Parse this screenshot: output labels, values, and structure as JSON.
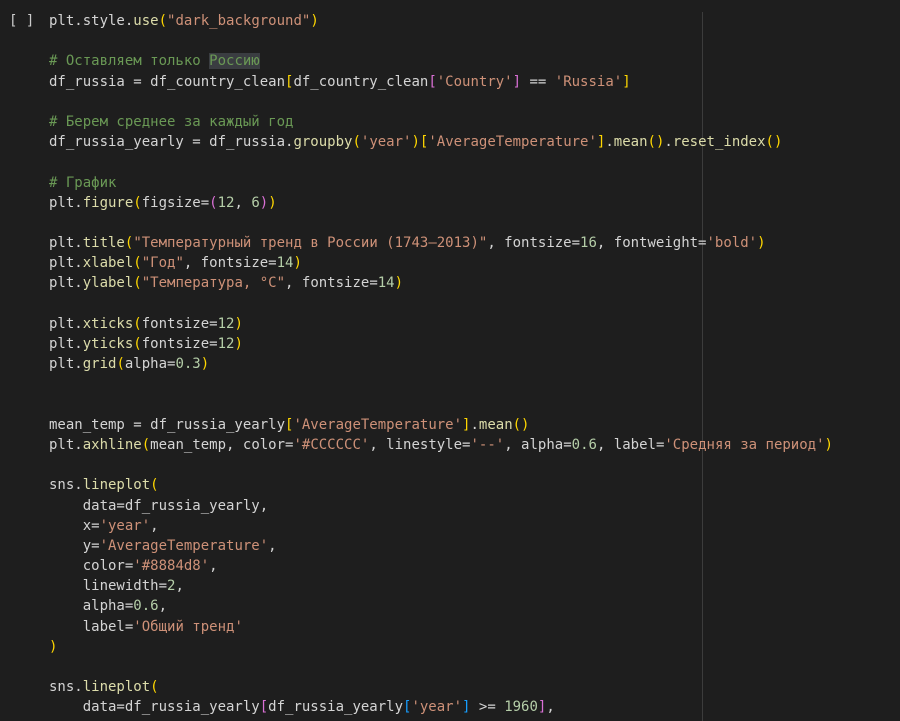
{
  "cell": {
    "run_indicator": "[ ]"
  },
  "code_lines": [
    [
      {
        "t": "plt.style.",
        "c": "plain"
      },
      {
        "t": "use",
        "c": "func"
      },
      {
        "t": "(",
        "c": "b1"
      },
      {
        "t": "\"dark_background\"",
        "c": "str"
      },
      {
        "t": ")",
        "c": "b1"
      }
    ],
    [],
    [
      {
        "t": "# Оставляем только ",
        "c": "comment"
      },
      {
        "t": "Россию",
        "c": "comment",
        "hl": true
      }
    ],
    [
      {
        "t": "df_russia = df_country_clean",
        "c": "plain"
      },
      {
        "t": "[",
        "c": "b1"
      },
      {
        "t": "df_country_clean",
        "c": "plain"
      },
      {
        "t": "[",
        "c": "b2"
      },
      {
        "t": "'Country'",
        "c": "str"
      },
      {
        "t": "]",
        "c": "b2"
      },
      {
        "t": " == ",
        "c": "plain"
      },
      {
        "t": "'Russia'",
        "c": "str"
      },
      {
        "t": "]",
        "c": "b1"
      }
    ],
    [],
    [
      {
        "t": "# Берем среднее за каждый год",
        "c": "comment"
      }
    ],
    [
      {
        "t": "df_russia_yearly = df_russia.",
        "c": "plain"
      },
      {
        "t": "groupby",
        "c": "func"
      },
      {
        "t": "(",
        "c": "b1"
      },
      {
        "t": "'year'",
        "c": "str"
      },
      {
        "t": ")",
        "c": "b1"
      },
      {
        "t": "[",
        "c": "b1"
      },
      {
        "t": "'AverageTemperature'",
        "c": "str"
      },
      {
        "t": "]",
        "c": "b1"
      },
      {
        "t": ".",
        "c": "plain"
      },
      {
        "t": "mean",
        "c": "func"
      },
      {
        "t": "()",
        "c": "b1"
      },
      {
        "t": ".",
        "c": "plain"
      },
      {
        "t": "reset_index",
        "c": "func"
      },
      {
        "t": "()",
        "c": "b1"
      }
    ],
    [],
    [
      {
        "t": "# График",
        "c": "comment"
      }
    ],
    [
      {
        "t": "plt.",
        "c": "plain"
      },
      {
        "t": "figure",
        "c": "func"
      },
      {
        "t": "(",
        "c": "b1"
      },
      {
        "t": "figsize=",
        "c": "plain"
      },
      {
        "t": "(",
        "c": "b2"
      },
      {
        "t": "12",
        "c": "num"
      },
      {
        "t": ", ",
        "c": "plain"
      },
      {
        "t": "6",
        "c": "num"
      },
      {
        "t": ")",
        "c": "b2"
      },
      {
        "t": ")",
        "c": "b1"
      }
    ],
    [],
    [
      {
        "t": "plt.",
        "c": "plain"
      },
      {
        "t": "title",
        "c": "func"
      },
      {
        "t": "(",
        "c": "b1"
      },
      {
        "t": "\"Температурный тренд в России (1743–2013)\"",
        "c": "str"
      },
      {
        "t": ", fontsize=",
        "c": "plain"
      },
      {
        "t": "16",
        "c": "num"
      },
      {
        "t": ", fontweight=",
        "c": "plain"
      },
      {
        "t": "'bold'",
        "c": "str"
      },
      {
        "t": ")",
        "c": "b1"
      }
    ],
    [
      {
        "t": "plt.",
        "c": "plain"
      },
      {
        "t": "xlabel",
        "c": "func"
      },
      {
        "t": "(",
        "c": "b1"
      },
      {
        "t": "\"Год\"",
        "c": "str"
      },
      {
        "t": ", fontsize=",
        "c": "plain"
      },
      {
        "t": "14",
        "c": "num"
      },
      {
        "t": ")",
        "c": "b1"
      }
    ],
    [
      {
        "t": "plt.",
        "c": "plain"
      },
      {
        "t": "ylabel",
        "c": "func"
      },
      {
        "t": "(",
        "c": "b1"
      },
      {
        "t": "\"Температура, °C\"",
        "c": "str"
      },
      {
        "t": ", fontsize=",
        "c": "plain"
      },
      {
        "t": "14",
        "c": "num"
      },
      {
        "t": ")",
        "c": "b1"
      }
    ],
    [],
    [
      {
        "t": "plt.",
        "c": "plain"
      },
      {
        "t": "xticks",
        "c": "func"
      },
      {
        "t": "(",
        "c": "b1"
      },
      {
        "t": "fontsize=",
        "c": "plain"
      },
      {
        "t": "12",
        "c": "num"
      },
      {
        "t": ")",
        "c": "b1"
      }
    ],
    [
      {
        "t": "plt.",
        "c": "plain"
      },
      {
        "t": "yticks",
        "c": "func"
      },
      {
        "t": "(",
        "c": "b1"
      },
      {
        "t": "fontsize=",
        "c": "plain"
      },
      {
        "t": "12",
        "c": "num"
      },
      {
        "t": ")",
        "c": "b1"
      }
    ],
    [
      {
        "t": "plt.",
        "c": "plain"
      },
      {
        "t": "grid",
        "c": "func"
      },
      {
        "t": "(",
        "c": "b1"
      },
      {
        "t": "alpha=",
        "c": "plain"
      },
      {
        "t": "0.3",
        "c": "num"
      },
      {
        "t": ")",
        "c": "b1"
      }
    ],
    [],
    [],
    [
      {
        "t": "mean_temp = df_russia_yearly",
        "c": "plain"
      },
      {
        "t": "[",
        "c": "b1"
      },
      {
        "t": "'AverageTemperature'",
        "c": "str"
      },
      {
        "t": "]",
        "c": "b1"
      },
      {
        "t": ".",
        "c": "plain"
      },
      {
        "t": "mean",
        "c": "func"
      },
      {
        "t": "()",
        "c": "b1"
      }
    ],
    [
      {
        "t": "plt.",
        "c": "plain"
      },
      {
        "t": "axhline",
        "c": "func"
      },
      {
        "t": "(",
        "c": "b1"
      },
      {
        "t": "mean_temp, color=",
        "c": "plain"
      },
      {
        "t": "'#CCCCCC'",
        "c": "str"
      },
      {
        "t": ", linestyle=",
        "c": "plain"
      },
      {
        "t": "'--'",
        "c": "str"
      },
      {
        "t": ", alpha=",
        "c": "plain"
      },
      {
        "t": "0.6",
        "c": "num"
      },
      {
        "t": ", label=",
        "c": "plain"
      },
      {
        "t": "'Средняя за период'",
        "c": "str"
      },
      {
        "t": ")",
        "c": "b1"
      }
    ],
    [],
    [
      {
        "t": "sns.",
        "c": "plain"
      },
      {
        "t": "lineplot",
        "c": "func"
      },
      {
        "t": "(",
        "c": "b1"
      }
    ],
    [
      {
        "t": "    data=df_russia_yearly,",
        "c": "plain"
      }
    ],
    [
      {
        "t": "    x=",
        "c": "plain"
      },
      {
        "t": "'year'",
        "c": "str"
      },
      {
        "t": ",",
        "c": "plain"
      }
    ],
    [
      {
        "t": "    y=",
        "c": "plain"
      },
      {
        "t": "'AverageTemperature'",
        "c": "str"
      },
      {
        "t": ",",
        "c": "plain"
      }
    ],
    [
      {
        "t": "    color=",
        "c": "plain"
      },
      {
        "t": "'#8884d8'",
        "c": "str"
      },
      {
        "t": ",",
        "c": "plain"
      }
    ],
    [
      {
        "t": "    linewidth=",
        "c": "plain"
      },
      {
        "t": "2",
        "c": "num"
      },
      {
        "t": ",",
        "c": "plain"
      }
    ],
    [
      {
        "t": "    alpha=",
        "c": "plain"
      },
      {
        "t": "0.6",
        "c": "num"
      },
      {
        "t": ",",
        "c": "plain"
      }
    ],
    [
      {
        "t": "    label=",
        "c": "plain"
      },
      {
        "t": "'Общий тренд'",
        "c": "str"
      }
    ],
    [
      {
        "t": ")",
        "c": "b1"
      }
    ],
    [],
    [
      {
        "t": "sns.",
        "c": "plain"
      },
      {
        "t": "lineplot",
        "c": "func"
      },
      {
        "t": "(",
        "c": "b1"
      }
    ],
    [
      {
        "t": "    data=df_russia_yearly",
        "c": "plain"
      },
      {
        "t": "[",
        "c": "b2"
      },
      {
        "t": "df_russia_yearly",
        "c": "plain"
      },
      {
        "t": "[",
        "c": "b3"
      },
      {
        "t": "'year'",
        "c": "str"
      },
      {
        "t": "]",
        "c": "b3"
      },
      {
        "t": " >= ",
        "c": "plain"
      },
      {
        "t": "1960",
        "c": "num"
      },
      {
        "t": "]",
        "c": "b2"
      },
      {
        "t": ",",
        "c": "plain"
      }
    ]
  ],
  "colors": {
    "background": "#1e1e1e",
    "function": "#dcdcaa",
    "string": "#ce9178",
    "number": "#b5cea8",
    "comment": "#6a9955",
    "bracket_level_1": "#ffd700",
    "bracket_level_2": "#da70d6",
    "bracket_level_3": "#179fff"
  }
}
